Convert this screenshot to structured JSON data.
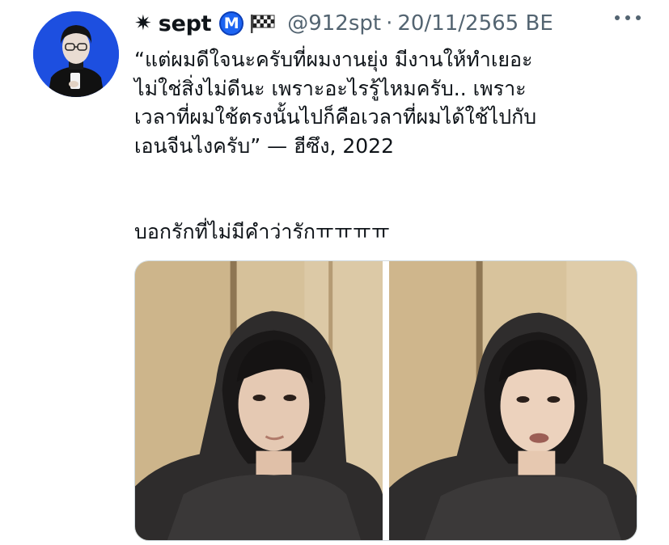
{
  "tweet": {
    "author": {
      "name_prefix": "✷",
      "display_name": "sept",
      "badge_letter": "M",
      "handle": "@912spt",
      "separator": "·",
      "date": "20/11/2565 BE"
    },
    "text_lines": [
      "“แต่ผมดีใจนะครับที่ผมงานยุ่ง มีงานให้ทำเยอะ",
      "ไม่ใช่สิ่งไม่ดีนะ เพราะอะไรรู้ไหมครับ.. เพราะ",
      "เวลาที่ผมใช้ตรงนั้นไปก็คือเวลาที่ผมได้ใช้ไปกับ",
      "เอนจีนไงครับ” — ฮีซึง, 2022",
      "บอกรักที่ไม่มีคำว่ารักㅠㅠㅠㅠ"
    ],
    "icons": {
      "badge": "m-badge-icon",
      "flag": "checkered-flag-icon",
      "more": "more-options-icon"
    },
    "colors": {
      "avatar_bg": "#1d4fe0",
      "badge_bg": "#1d64f2",
      "secondary_text": "#536471"
    }
  }
}
